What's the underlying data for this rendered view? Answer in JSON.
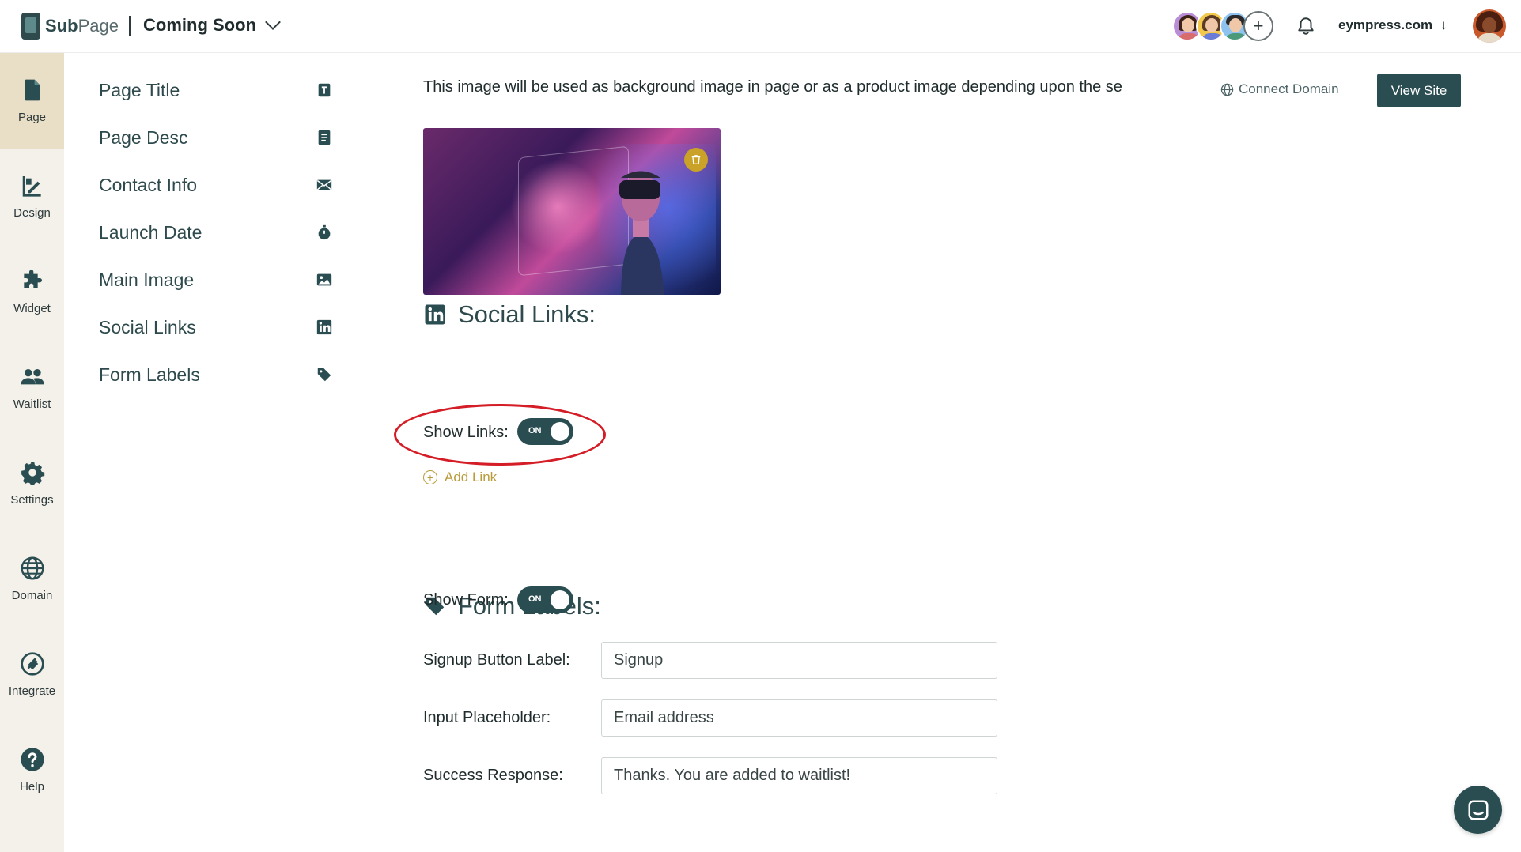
{
  "header": {
    "brand_bold": "Sub",
    "brand_light": "Page",
    "project_name": "Coming Soon",
    "domain": "eympress.com",
    "domain_arrow": "↓",
    "add_collaborator": "+"
  },
  "rail": {
    "items": [
      {
        "label": "Page",
        "icon": "page-icon"
      },
      {
        "label": "Design",
        "icon": "design-icon"
      },
      {
        "label": "Widget",
        "icon": "puzzle-icon"
      },
      {
        "label": "Waitlist",
        "icon": "users-icon"
      },
      {
        "label": "Settings",
        "icon": "gear-icon"
      },
      {
        "label": "Domain",
        "icon": "globe-icon"
      },
      {
        "label": "Integrate",
        "icon": "plug-icon"
      },
      {
        "label": "Help",
        "icon": "help-icon"
      }
    ]
  },
  "submenu": {
    "items": [
      {
        "label": "Page Title",
        "icon": "text-icon"
      },
      {
        "label": "Page Desc",
        "icon": "document-icon"
      },
      {
        "label": "Contact Info",
        "icon": "envelope-icon"
      },
      {
        "label": "Launch Date",
        "icon": "stopwatch-icon"
      },
      {
        "label": "Main Image",
        "icon": "image-icon"
      },
      {
        "label": "Social Links",
        "icon": "linkedin-icon"
      },
      {
        "label": "Form Labels",
        "icon": "tag-icon"
      }
    ]
  },
  "main": {
    "image_description": "This image will be used as background image in page or as a product image depending upon the se",
    "connect_domain": "Connect Domain",
    "view_site": "View Site",
    "social": {
      "title": "Social Links:",
      "show_links_label": "Show Links:",
      "toggle_text": "ON",
      "add_link": "Add Link"
    },
    "form": {
      "title": "Form Labels:",
      "show_form_label": "Show Form:",
      "toggle_text": "ON",
      "signup_label": "Signup Button Label:",
      "signup_value": "Signup",
      "placeholder_label": "Input Placeholder:",
      "placeholder_value": "Email address",
      "success_label": "Success Response:",
      "success_value": "Thanks. You are added to waitlist!"
    }
  },
  "colors": {
    "primary": "#2a4d51",
    "accent_gold": "#b99b3a",
    "rail_bg": "#f3f1ea",
    "rail_active": "#e9dfc6",
    "highlight": "#d41d26"
  }
}
